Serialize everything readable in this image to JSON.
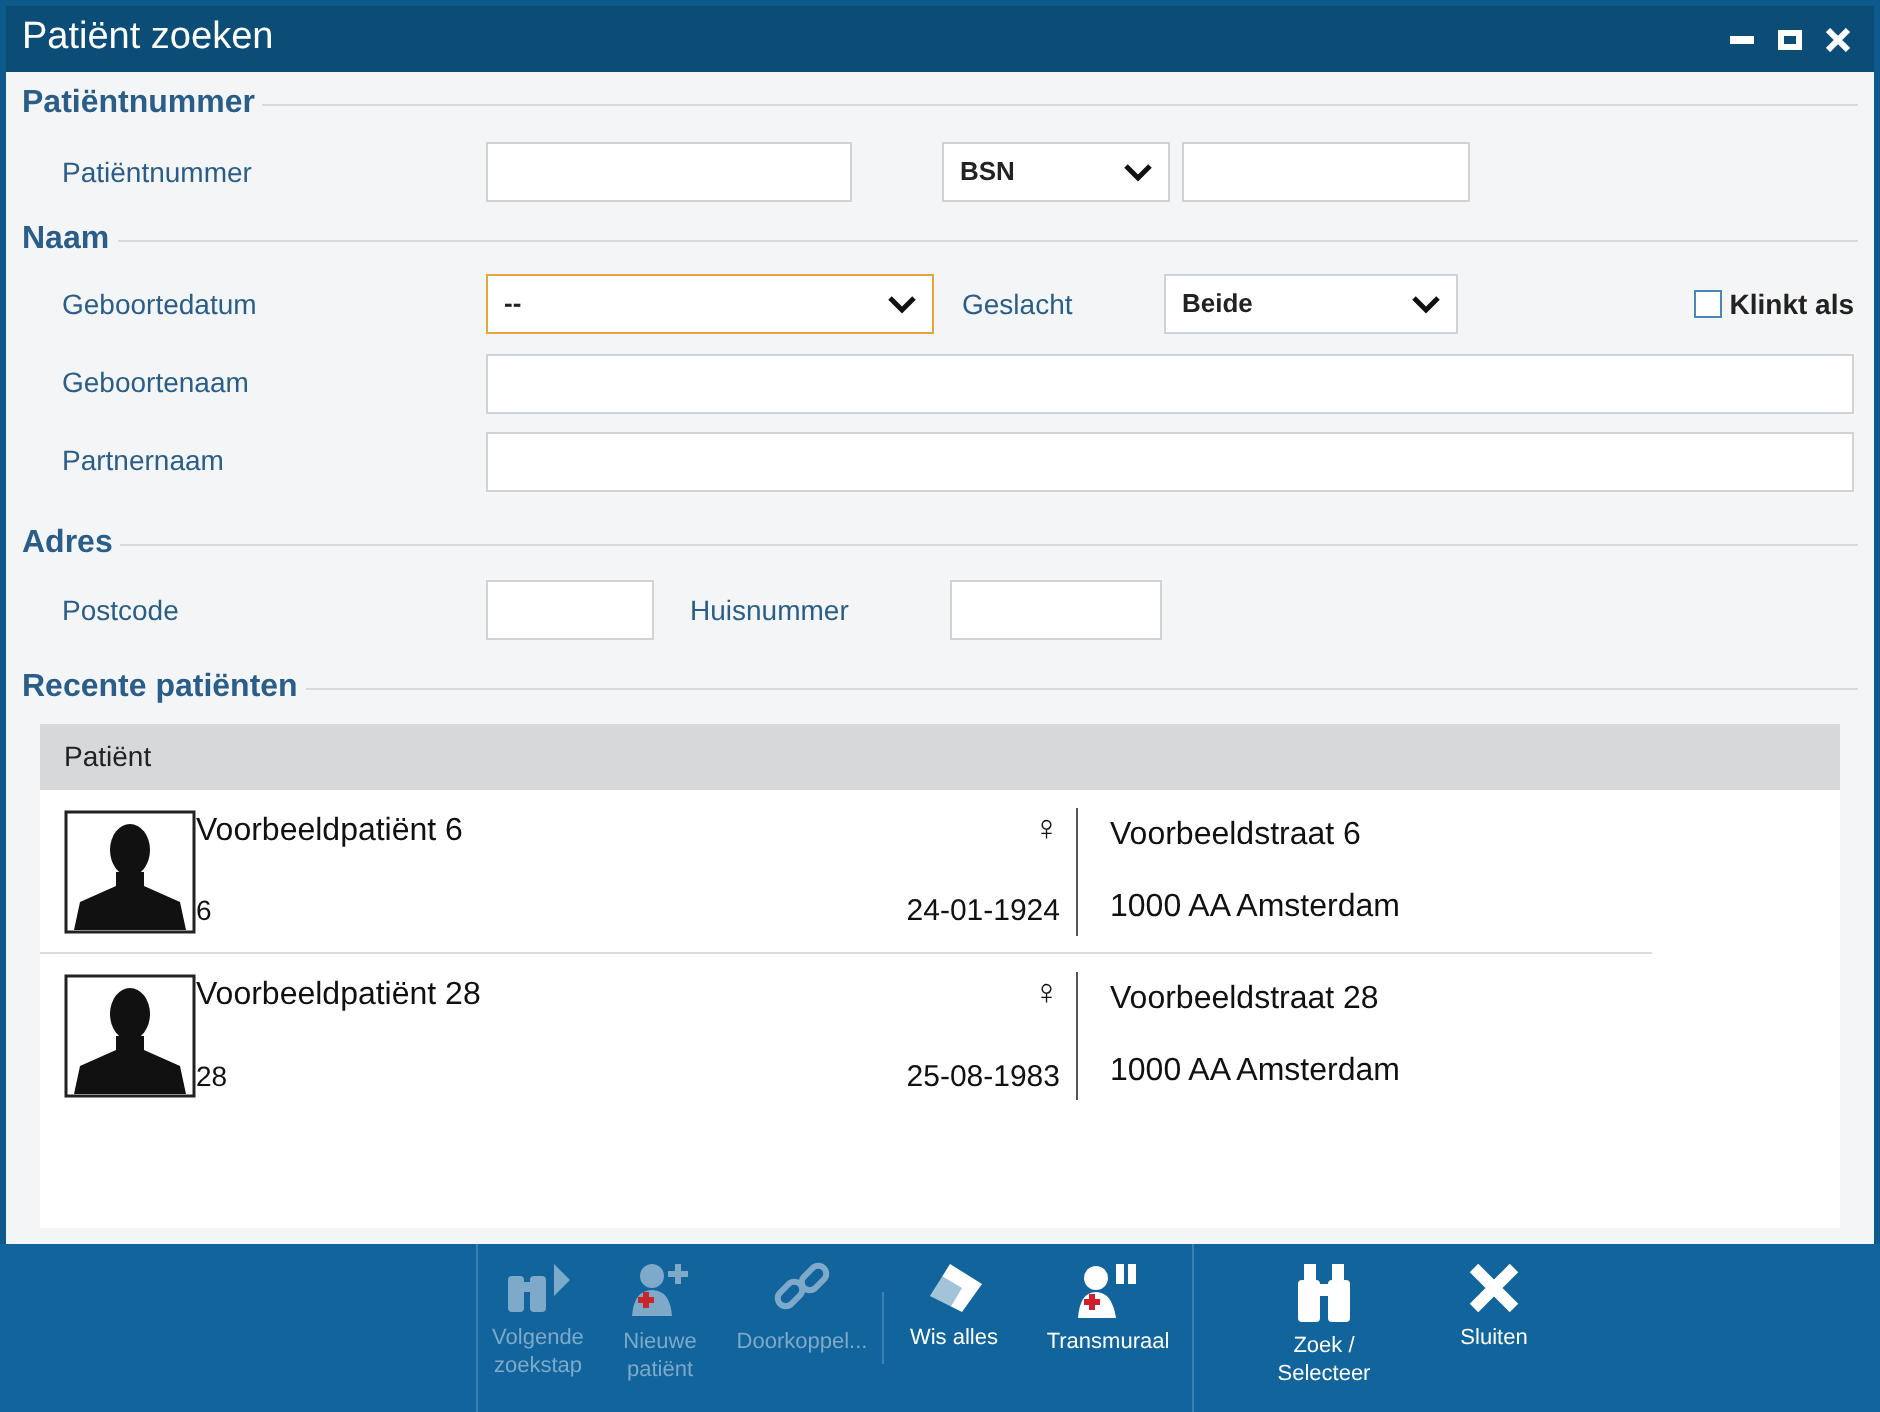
{
  "window": {
    "title": "Patiënt zoeken"
  },
  "sections": [
    {
      "title": "Patiëntnummer"
    },
    {
      "title": "Naam"
    },
    {
      "title": "Adres"
    },
    {
      "title": "Recente patiënten"
    }
  ],
  "patient_number": {
    "label": "Patiëntnummer",
    "value_type": "BSN"
  },
  "name": {
    "birthdate_label": "Geboortedatum",
    "birthdate_value": "--",
    "birthdate_focused": true,
    "gender_label": "Geslacht",
    "gender_value": "Beide",
    "sounds_like": {
      "label": "Klinkt als",
      "checked": false
    },
    "birth_name_label": "Geboortenaam",
    "partner_name_label": "Partnernaam"
  },
  "address": {
    "postcode_label": "Postcode",
    "house_number_label": "Huisnummer"
  },
  "table": {
    "columns": [
      "Patiënt"
    ],
    "rows": [
      {
        "name": "Voorbeeldpatiënt 6",
        "number": "6",
        "gender": "♀",
        "birthdate": "24-01-1924",
        "street": "Voorbeeldstraat 6",
        "city": "1000 AA Amsterdam"
      },
      {
        "name": "Voorbeeldpatiënt 28",
        "number": "28",
        "gender": "♀",
        "birthdate": "25-08-1983",
        "street": "Voorbeeldstraat 28",
        "city": "1000 AA Amsterdam"
      }
    ]
  },
  "toolbar": [
    {
      "kind": "next",
      "label": "Volgende zoekstap",
      "disabled": true
    },
    {
      "kind": "new",
      "label": "Nieuwe patiënt",
      "disabled": true
    },
    {
      "kind": "link",
      "label": "Doorkoppel...",
      "disabled": true
    },
    {
      "kind": "clear",
      "label": "Wis alles",
      "disabled": false
    },
    {
      "kind": "transmural",
      "label": "Transmuraal",
      "disabled": false
    },
    {
      "kind": "search",
      "label": "Zoek / Selecteer",
      "disabled": false
    },
    {
      "kind": "close",
      "label": "Sluiten",
      "disabled": false
    }
  ]
}
